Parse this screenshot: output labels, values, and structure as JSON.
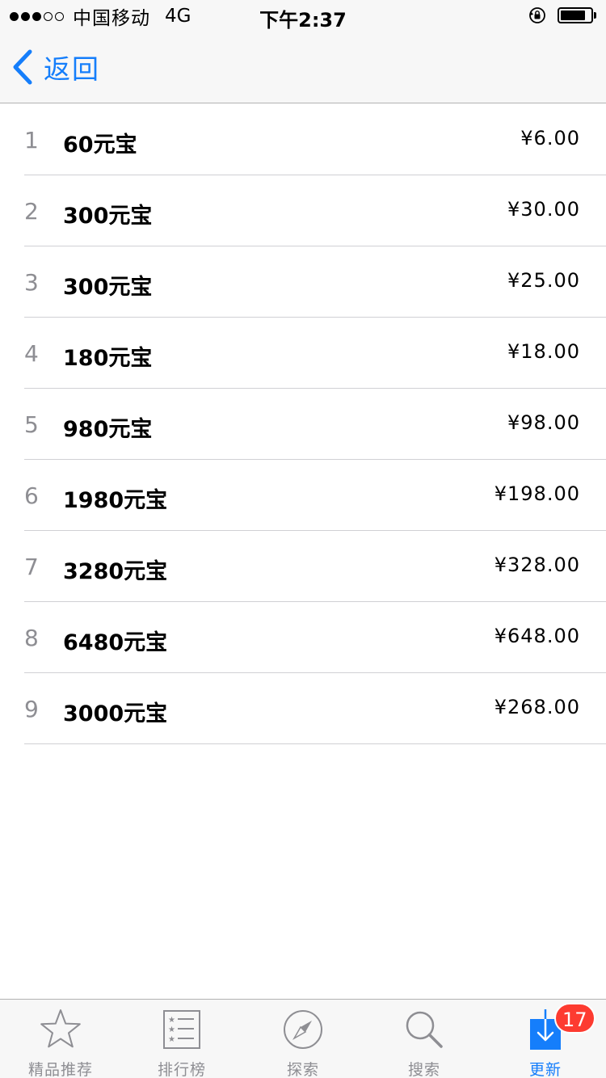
{
  "status_bar": {
    "signal_filled": 3,
    "signal_total": 5,
    "carrier": "中国移动",
    "network": "4G",
    "time": "下午2:37",
    "battery_level": 0.85,
    "icons": [
      "orientation-lock-icon",
      "battery-icon"
    ]
  },
  "nav": {
    "back_label": "返回",
    "back_icon": "chevron-left-icon",
    "accent_color": "#157efb"
  },
  "items": [
    {
      "index": "1",
      "name": "60元宝",
      "price": "¥6.00"
    },
    {
      "index": "2",
      "name": "300元宝",
      "price": "¥30.00"
    },
    {
      "index": "3",
      "name": "300元宝",
      "price": "¥25.00"
    },
    {
      "index": "4",
      "name": "180元宝",
      "price": "¥18.00"
    },
    {
      "index": "5",
      "name": "980元宝",
      "price": "¥98.00"
    },
    {
      "index": "6",
      "name": "1980元宝",
      "price": "¥198.00"
    },
    {
      "index": "7",
      "name": "3280元宝",
      "price": "¥328.00"
    },
    {
      "index": "8",
      "name": "6480元宝",
      "price": "¥648.00"
    },
    {
      "index": "9",
      "name": "3000元宝",
      "price": "¥268.00"
    }
  ],
  "tab_bar": {
    "tabs": [
      {
        "label": "精品推荐",
        "icon": "star-icon",
        "active": false
      },
      {
        "label": "排行榜",
        "icon": "ranked-list-icon",
        "active": false
      },
      {
        "label": "探索",
        "icon": "compass-icon",
        "active": false
      },
      {
        "label": "搜索",
        "icon": "search-icon",
        "active": false
      },
      {
        "label": "更新",
        "icon": "download-icon",
        "active": true
      }
    ],
    "updates_badge": "17",
    "badge_color": "#fd3b30"
  }
}
